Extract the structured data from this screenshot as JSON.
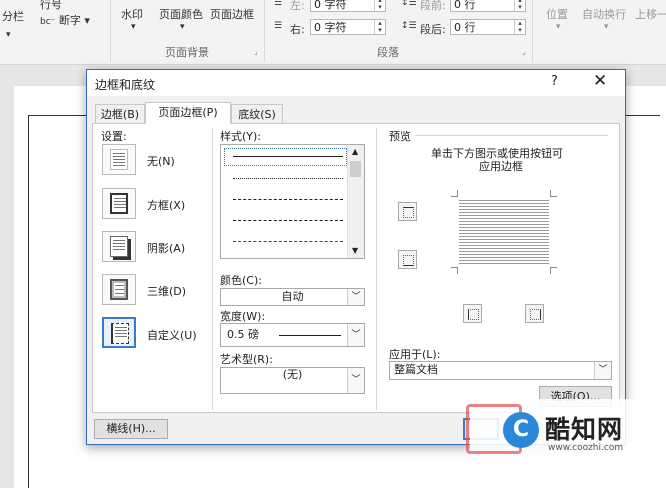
{
  "ribbon": {
    "columns": "分栏",
    "line_numbers": "行号",
    "hyphenation": "断字",
    "watermark": "水印",
    "page_color": "页面颜色",
    "page_borders": "页面边框",
    "page_background": "页面背景",
    "indent_left_label": "左:",
    "indent_left_value": "0 字符",
    "indent_right_label": "右:",
    "indent_right_value": "0 字符",
    "spacing_before_label": "段前:",
    "spacing_before_value": "0 行",
    "spacing_after_label": "段后:",
    "spacing_after_value": "0 行",
    "paragraph": "段落",
    "position": "位置",
    "wrap_text": "自动换行",
    "bring_forward": "上移一"
  },
  "dialog": {
    "title": "边框和底纹",
    "help": "?",
    "close": "✕",
    "tabs": [
      "边框(B)",
      "页面边框(P)",
      "底纹(S)"
    ],
    "settings_label": "设置:",
    "settings": [
      "无(N)",
      "方框(X)",
      "阴影(A)",
      "三维(D)",
      "自定义(U)"
    ],
    "style_label": "样式(Y):",
    "color_label": "颜色(C):",
    "color_value": "自动",
    "width_label": "宽度(W):",
    "width_value": "0.5 磅",
    "art_label": "艺术型(R):",
    "art_value": "(无)",
    "preview_label": "预览",
    "preview_hint_1": "单击下方图示或使用按钮可",
    "preview_hint_2": "应用边框",
    "apply_label": "应用于(L):",
    "apply_value": "整篇文档",
    "options_button": "选项(O)...",
    "horizontal_line_button": "横线(H)..."
  },
  "watermark_logo": {
    "name": "酷知网",
    "url": "www.coozhi.com"
  }
}
